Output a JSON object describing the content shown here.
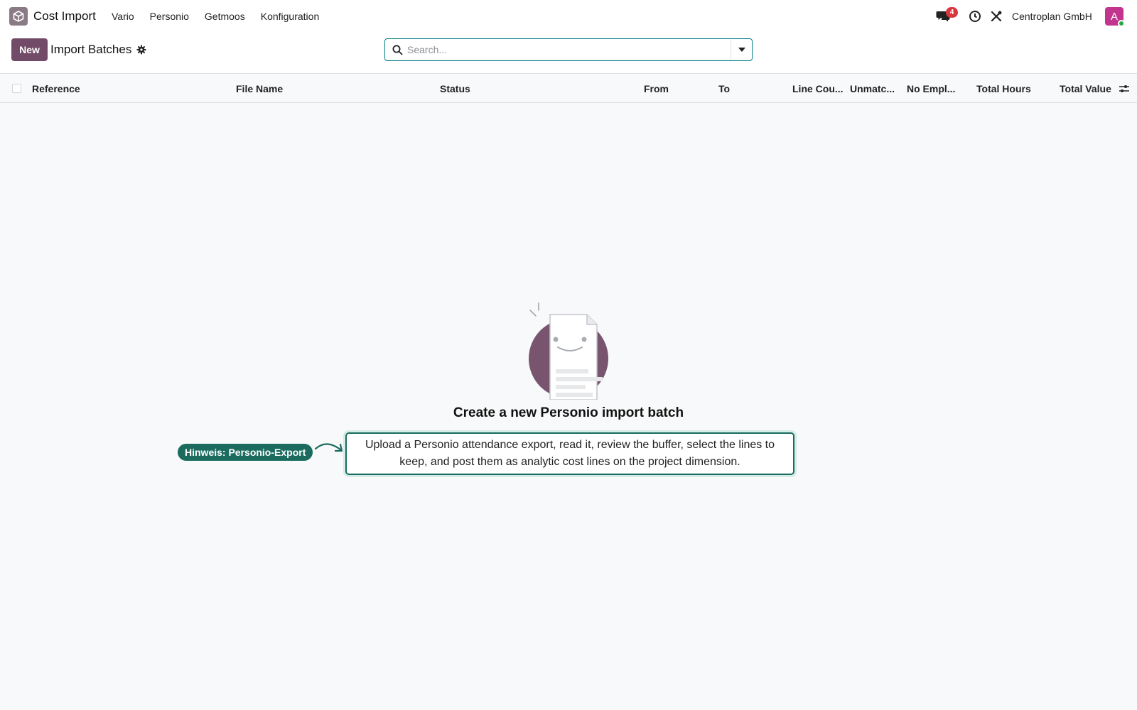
{
  "app": {
    "title": "Cost Import",
    "icon": "cube-app-icon"
  },
  "menu": {
    "items": [
      {
        "label": "Vario"
      },
      {
        "label": "Personio"
      },
      {
        "label": "Getmoos"
      },
      {
        "label": "Konfiguration"
      }
    ]
  },
  "systray": {
    "messages_badge": "4",
    "company": "Centroplan GmbH",
    "avatar_letter": "A",
    "avatar_color": "#c2358f"
  },
  "control_panel": {
    "new_label": "New",
    "breadcrumb": "Import Batches",
    "search_placeholder": "Search..."
  },
  "table": {
    "columns": [
      {
        "label": "Reference"
      },
      {
        "label": "File Name"
      },
      {
        "label": "Status"
      },
      {
        "label": "From"
      },
      {
        "label": "To"
      },
      {
        "label": "Line Cou..."
      },
      {
        "label": "Unmatc..."
      },
      {
        "label": "No Empl..."
      },
      {
        "label": "Total Hours"
      },
      {
        "label": "Total Value"
      }
    ]
  },
  "empty_state": {
    "title": "Create a new Personio import batch",
    "help_text": "Upload a Personio attendance export, read it, review the buffer, select the lines to keep, and post them as analytic cost lines on the project dimension.",
    "hint_badge": "Hinweis: Personio-Export"
  },
  "colors": {
    "brand": "#714b67",
    "accent": "#017e84",
    "hint": "#1b6b5e",
    "badge": "#d9363e"
  }
}
